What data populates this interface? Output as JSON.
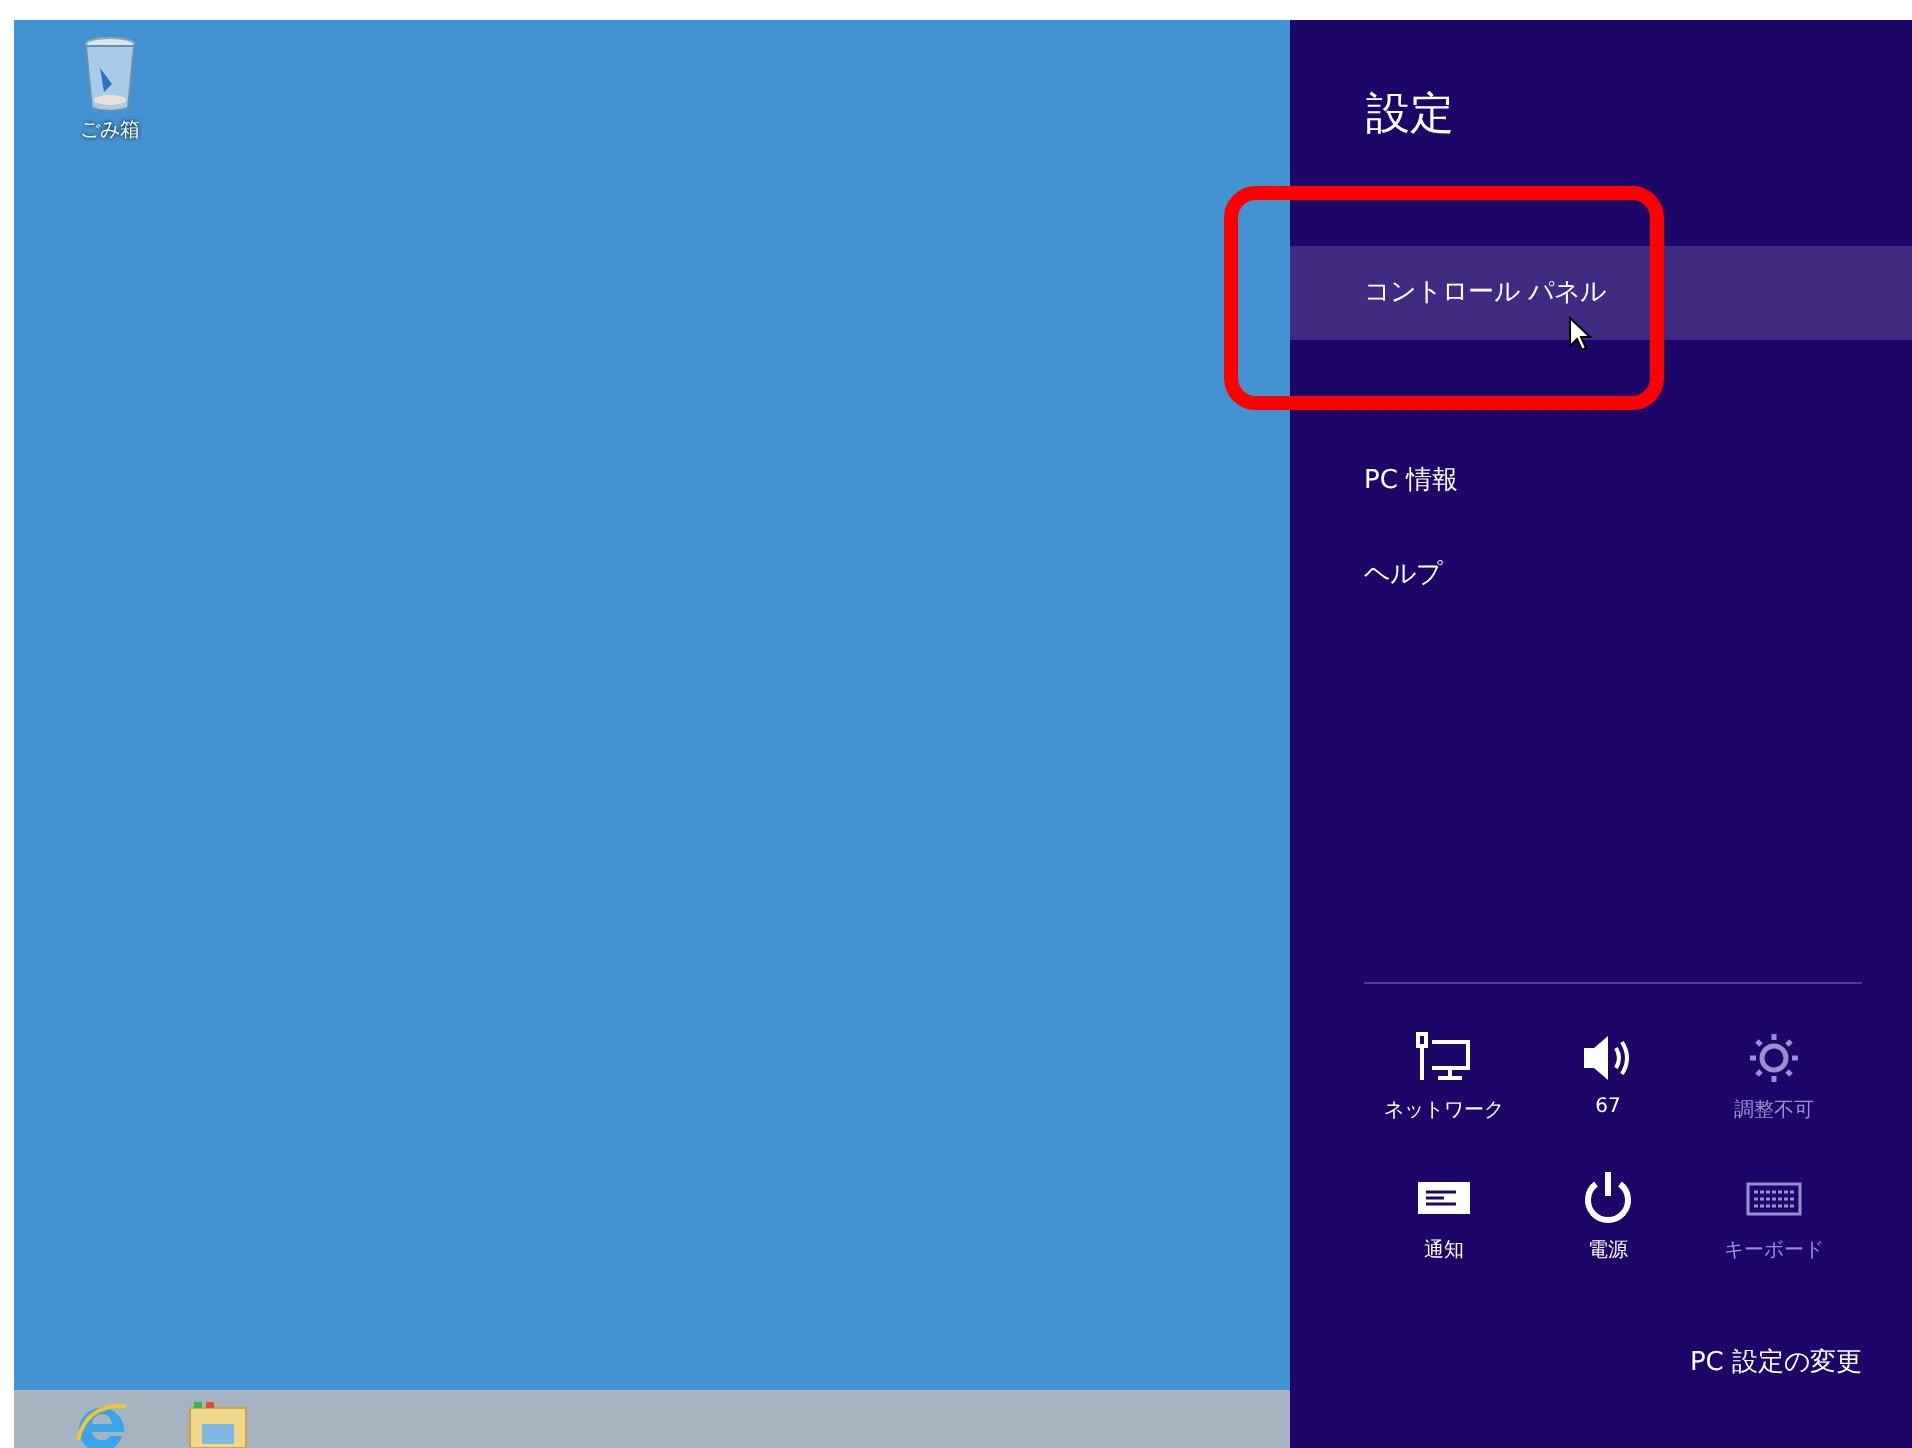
{
  "desktop": {
    "icons": [
      {
        "label": "ごみ箱",
        "kind": "recycle-bin"
      }
    ]
  },
  "taskbar": {
    "items": [
      {
        "kind": "browser"
      },
      {
        "kind": "folder"
      }
    ]
  },
  "charm": {
    "title": "設定",
    "items": [
      {
        "label": "コントロール パネル",
        "selected": true
      },
      {
        "label": "PC 情報",
        "selected": false
      },
      {
        "label": "ヘルプ",
        "selected": false
      }
    ],
    "quick": [
      {
        "kind": "network",
        "label": "ネットワーク",
        "disabled": false
      },
      {
        "kind": "volume",
        "label": "67",
        "disabled": false
      },
      {
        "kind": "brightness",
        "label": "調整不可",
        "disabled": true
      },
      {
        "kind": "notifications",
        "label": "通知",
        "disabled": false
      },
      {
        "kind": "power",
        "label": "電源",
        "disabled": false
      },
      {
        "kind": "keyboard",
        "label": "キーボード",
        "disabled": true
      }
    ],
    "footer_link": "PC 設定の変更"
  }
}
